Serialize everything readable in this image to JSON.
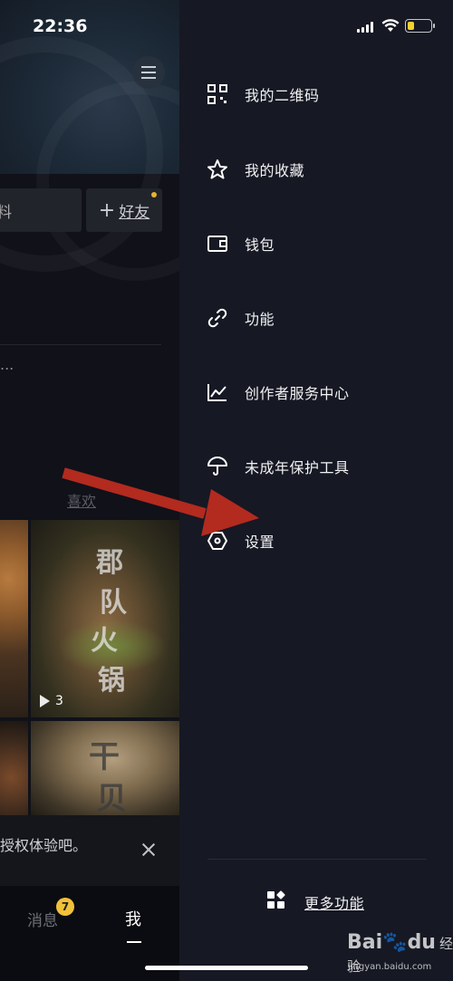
{
  "status_bar": {
    "time": "22:36"
  },
  "profile": {
    "edit_label": "料",
    "add_friend_label": "好友",
    "ellipsis": "...",
    "liked_link": "喜欢",
    "play_count": "3",
    "tile_text_1": [
      "郡",
      "队",
      "火",
      "锅"
    ],
    "tile_text_2": [
      "干",
      "贝"
    ],
    "notice_text": "授权体验吧。",
    "tabbar": {
      "messages": "消息",
      "messages_badge": "7",
      "me": "我"
    }
  },
  "drawer": {
    "items": [
      {
        "label": "我的二维码",
        "icon": "qr-code-icon"
      },
      {
        "label": "我的收藏",
        "icon": "star-icon"
      },
      {
        "label": "钱包",
        "icon": "wallet-icon"
      },
      {
        "label": "功能",
        "icon": "link-icon"
      },
      {
        "label": "创作者服务中心",
        "icon": "chart-line-icon"
      },
      {
        "label": "未成年保护工具",
        "icon": "umbrella-icon"
      },
      {
        "label": "设置",
        "icon": "settings-hexagon-icon"
      }
    ],
    "more_label": "更多功能"
  },
  "watermark": {
    "brand": "Bai",
    "brand_suffix": "du",
    "tag": "经验",
    "url": "jingyan.baidu.com"
  },
  "colors": {
    "drawer_bg": "#161823",
    "arrow": "#b32a1f",
    "battery": "#f6d22f",
    "badge": "#f2c13a"
  }
}
